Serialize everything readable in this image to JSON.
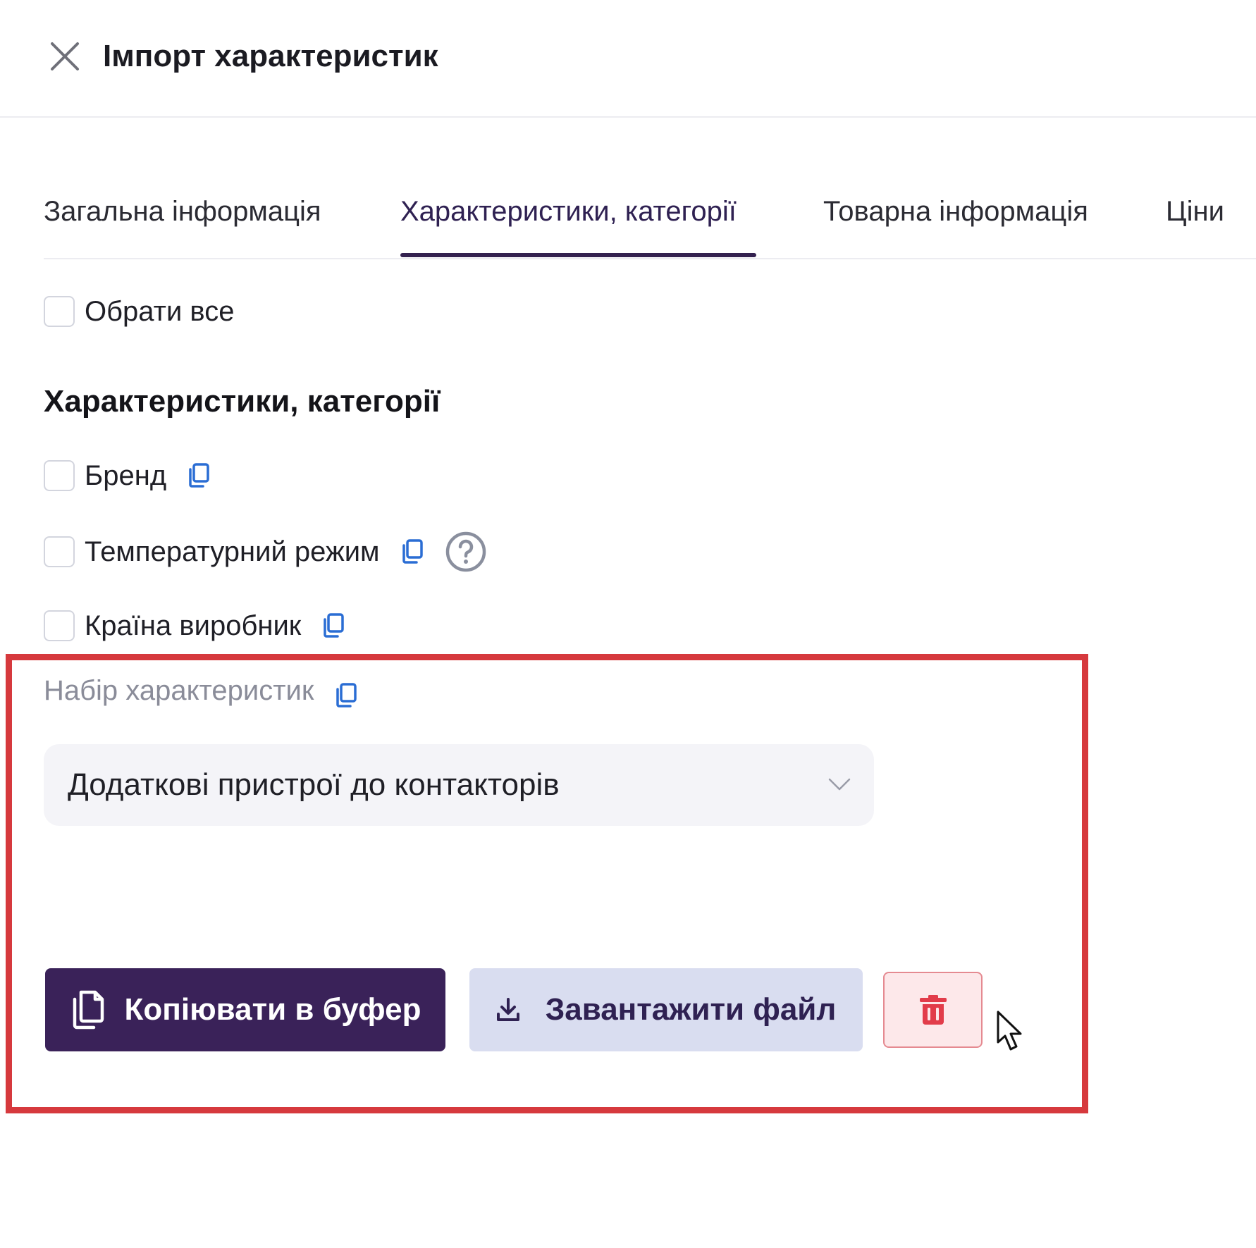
{
  "header": {
    "title": "Імпорт характеристик"
  },
  "tabs": [
    {
      "label": "Загальна інформація",
      "active": false
    },
    {
      "label": "Характеристики, категорії",
      "active": true
    },
    {
      "label": "Товарна інформація",
      "active": false
    },
    {
      "label": "Ціни",
      "active": false
    }
  ],
  "select_all": {
    "label": "Обрати все",
    "checked": false
  },
  "section": {
    "title": "Характеристики, категорії",
    "items": [
      {
        "label": "Бренд",
        "checked": false,
        "icons": [
          "copy-icon"
        ]
      },
      {
        "label": "Температурний режим",
        "checked": false,
        "icons": [
          "copy-icon",
          "help-icon"
        ]
      },
      {
        "label": "Країна виробник",
        "checked": false,
        "icons": [
          "copy-icon"
        ]
      }
    ]
  },
  "set_field": {
    "label": "Набір характеристик",
    "value": "Додаткові пристрої до контакторів"
  },
  "actions": {
    "copy_label": "Копіювати в буфер",
    "download_label": "Завантажити файл",
    "delete_icon": "trash-icon"
  },
  "colors": {
    "primary": "#3a2259",
    "secondary_bg": "#d9ddf0",
    "danger": "#e23c4a",
    "link_icon": "#2a6dd4",
    "highlight": "#d6393d"
  }
}
